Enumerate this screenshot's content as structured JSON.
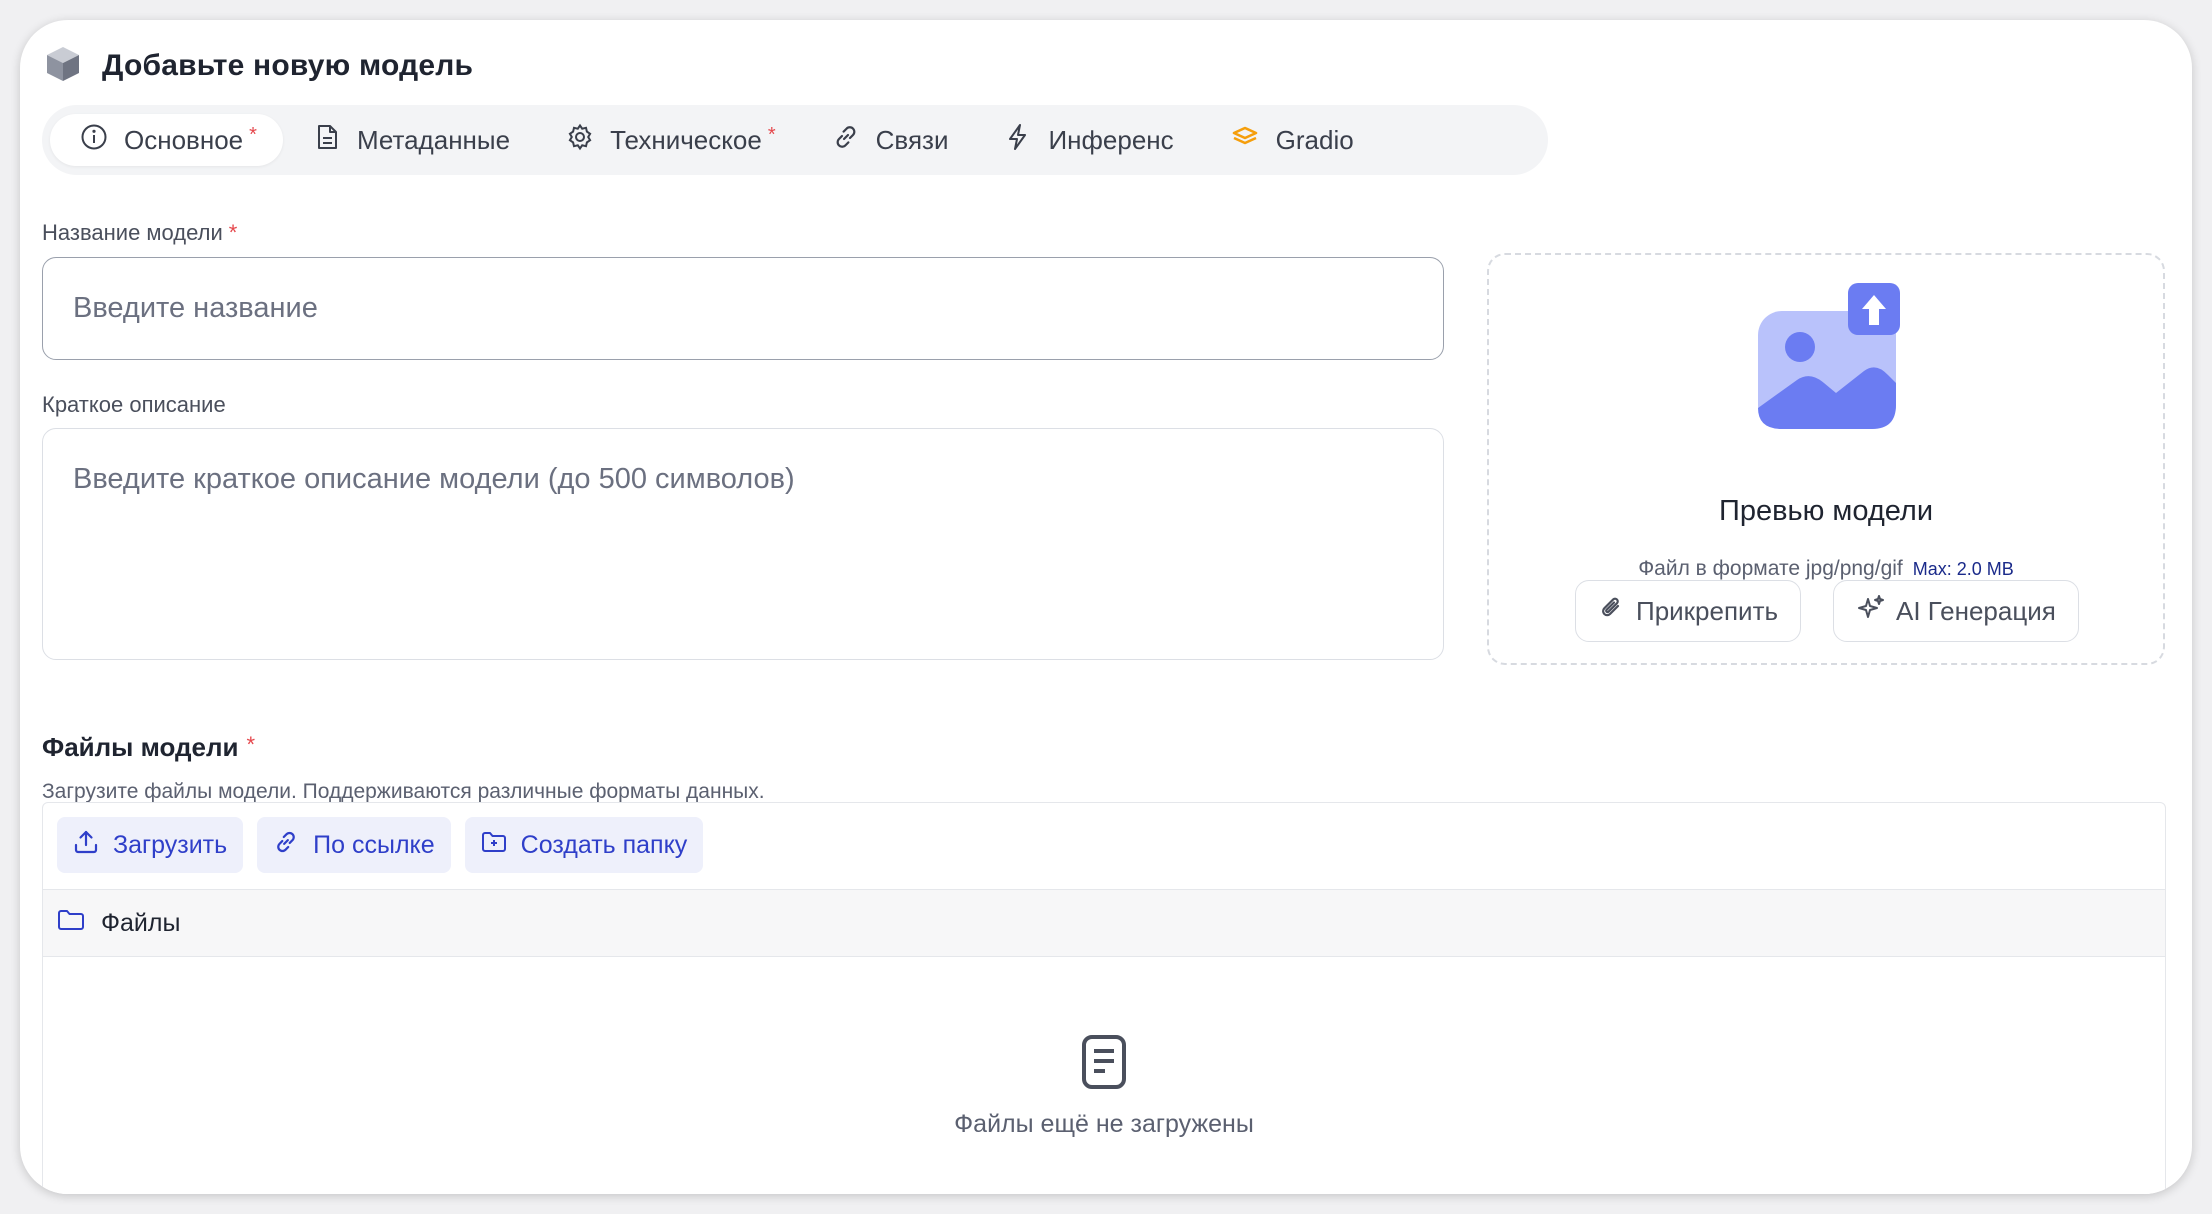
{
  "header": {
    "title": "Добавьте новую модель",
    "icon": "cube-icon"
  },
  "tabs": [
    {
      "label": "Основное",
      "required": "*",
      "icon": "info-icon",
      "active": true
    },
    {
      "label": "Метаданные",
      "icon": "document-icon"
    },
    {
      "label": "Техническое",
      "required": "*",
      "icon": "gear-icon"
    },
    {
      "label": "Связи",
      "icon": "link-icon"
    },
    {
      "label": "Инференс",
      "icon": "lightning-icon"
    },
    {
      "label": "Gradio",
      "icon": "gradio-icon"
    }
  ],
  "form": {
    "name_label": "Название модели",
    "required_mark": "*",
    "name_placeholder": "Введите название",
    "desc_label": "Краткое описание",
    "desc_placeholder": "Введите краткое описание модели (до 500 символов)"
  },
  "preview": {
    "title": "Превью модели",
    "hint": "Файл в формате jpg/png/gif",
    "max": "Max: 2.0 MB",
    "attach_label": "Прикрепить",
    "ai_label": "AI Генерация",
    "icon": "image-upload-icon"
  },
  "files": {
    "title": "Файлы модели",
    "required_mark": "*",
    "subtitle": "Загрузите файлы модели. Поддерживаются различные форматы данных.",
    "upload_label": "Загрузить",
    "link_label": "По ссылке",
    "folder_label": "Создать папку",
    "root_folder": "Файлы",
    "empty_text": "Файлы ещё не загружены"
  },
  "colors": {
    "accent": "#2f3fc9",
    "accent_bg": "#eef0fb",
    "required": "#e5484d",
    "gradio": "#f59e0b",
    "preview_icon": "#6b7cf2"
  }
}
